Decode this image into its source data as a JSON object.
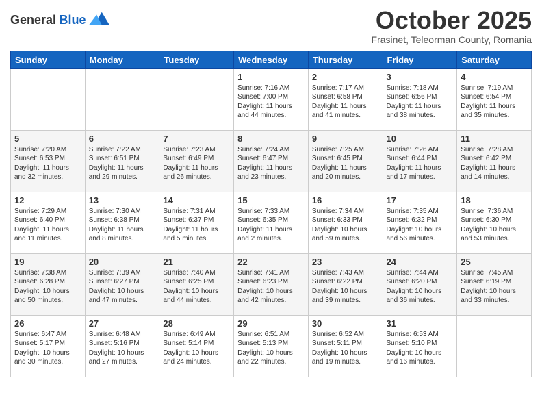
{
  "logo": {
    "general": "General",
    "blue": "Blue"
  },
  "header": {
    "month_title": "October 2025",
    "subtitle": "Frasinet, Teleorman County, Romania"
  },
  "days_of_week": [
    "Sunday",
    "Monday",
    "Tuesday",
    "Wednesday",
    "Thursday",
    "Friday",
    "Saturday"
  ],
  "weeks": [
    {
      "days": [
        {
          "number": "",
          "info": ""
        },
        {
          "number": "",
          "info": ""
        },
        {
          "number": "",
          "info": ""
        },
        {
          "number": "1",
          "info": "Sunrise: 7:16 AM\nSunset: 7:00 PM\nDaylight: 11 hours and 44 minutes."
        },
        {
          "number": "2",
          "info": "Sunrise: 7:17 AM\nSunset: 6:58 PM\nDaylight: 11 hours and 41 minutes."
        },
        {
          "number": "3",
          "info": "Sunrise: 7:18 AM\nSunset: 6:56 PM\nDaylight: 11 hours and 38 minutes."
        },
        {
          "number": "4",
          "info": "Sunrise: 7:19 AM\nSunset: 6:54 PM\nDaylight: 11 hours and 35 minutes."
        }
      ]
    },
    {
      "days": [
        {
          "number": "5",
          "info": "Sunrise: 7:20 AM\nSunset: 6:53 PM\nDaylight: 11 hours and 32 minutes."
        },
        {
          "number": "6",
          "info": "Sunrise: 7:22 AM\nSunset: 6:51 PM\nDaylight: 11 hours and 29 minutes."
        },
        {
          "number": "7",
          "info": "Sunrise: 7:23 AM\nSunset: 6:49 PM\nDaylight: 11 hours and 26 minutes."
        },
        {
          "number": "8",
          "info": "Sunrise: 7:24 AM\nSunset: 6:47 PM\nDaylight: 11 hours and 23 minutes."
        },
        {
          "number": "9",
          "info": "Sunrise: 7:25 AM\nSunset: 6:45 PM\nDaylight: 11 hours and 20 minutes."
        },
        {
          "number": "10",
          "info": "Sunrise: 7:26 AM\nSunset: 6:44 PM\nDaylight: 11 hours and 17 minutes."
        },
        {
          "number": "11",
          "info": "Sunrise: 7:28 AM\nSunset: 6:42 PM\nDaylight: 11 hours and 14 minutes."
        }
      ]
    },
    {
      "days": [
        {
          "number": "12",
          "info": "Sunrise: 7:29 AM\nSunset: 6:40 PM\nDaylight: 11 hours and 11 minutes."
        },
        {
          "number": "13",
          "info": "Sunrise: 7:30 AM\nSunset: 6:38 PM\nDaylight: 11 hours and 8 minutes."
        },
        {
          "number": "14",
          "info": "Sunrise: 7:31 AM\nSunset: 6:37 PM\nDaylight: 11 hours and 5 minutes."
        },
        {
          "number": "15",
          "info": "Sunrise: 7:33 AM\nSunset: 6:35 PM\nDaylight: 11 hours and 2 minutes."
        },
        {
          "number": "16",
          "info": "Sunrise: 7:34 AM\nSunset: 6:33 PM\nDaylight: 10 hours and 59 minutes."
        },
        {
          "number": "17",
          "info": "Sunrise: 7:35 AM\nSunset: 6:32 PM\nDaylight: 10 hours and 56 minutes."
        },
        {
          "number": "18",
          "info": "Sunrise: 7:36 AM\nSunset: 6:30 PM\nDaylight: 10 hours and 53 minutes."
        }
      ]
    },
    {
      "days": [
        {
          "number": "19",
          "info": "Sunrise: 7:38 AM\nSunset: 6:28 PM\nDaylight: 10 hours and 50 minutes."
        },
        {
          "number": "20",
          "info": "Sunrise: 7:39 AM\nSunset: 6:27 PM\nDaylight: 10 hours and 47 minutes."
        },
        {
          "number": "21",
          "info": "Sunrise: 7:40 AM\nSunset: 6:25 PM\nDaylight: 10 hours and 44 minutes."
        },
        {
          "number": "22",
          "info": "Sunrise: 7:41 AM\nSunset: 6:23 PM\nDaylight: 10 hours and 42 minutes."
        },
        {
          "number": "23",
          "info": "Sunrise: 7:43 AM\nSunset: 6:22 PM\nDaylight: 10 hours and 39 minutes."
        },
        {
          "number": "24",
          "info": "Sunrise: 7:44 AM\nSunset: 6:20 PM\nDaylight: 10 hours and 36 minutes."
        },
        {
          "number": "25",
          "info": "Sunrise: 7:45 AM\nSunset: 6:19 PM\nDaylight: 10 hours and 33 minutes."
        }
      ]
    },
    {
      "days": [
        {
          "number": "26",
          "info": "Sunrise: 6:47 AM\nSunset: 5:17 PM\nDaylight: 10 hours and 30 minutes."
        },
        {
          "number": "27",
          "info": "Sunrise: 6:48 AM\nSunset: 5:16 PM\nDaylight: 10 hours and 27 minutes."
        },
        {
          "number": "28",
          "info": "Sunrise: 6:49 AM\nSunset: 5:14 PM\nDaylight: 10 hours and 24 minutes."
        },
        {
          "number": "29",
          "info": "Sunrise: 6:51 AM\nSunset: 5:13 PM\nDaylight: 10 hours and 22 minutes."
        },
        {
          "number": "30",
          "info": "Sunrise: 6:52 AM\nSunset: 5:11 PM\nDaylight: 10 hours and 19 minutes."
        },
        {
          "number": "31",
          "info": "Sunrise: 6:53 AM\nSunset: 5:10 PM\nDaylight: 10 hours and 16 minutes."
        },
        {
          "number": "",
          "info": ""
        }
      ]
    }
  ]
}
